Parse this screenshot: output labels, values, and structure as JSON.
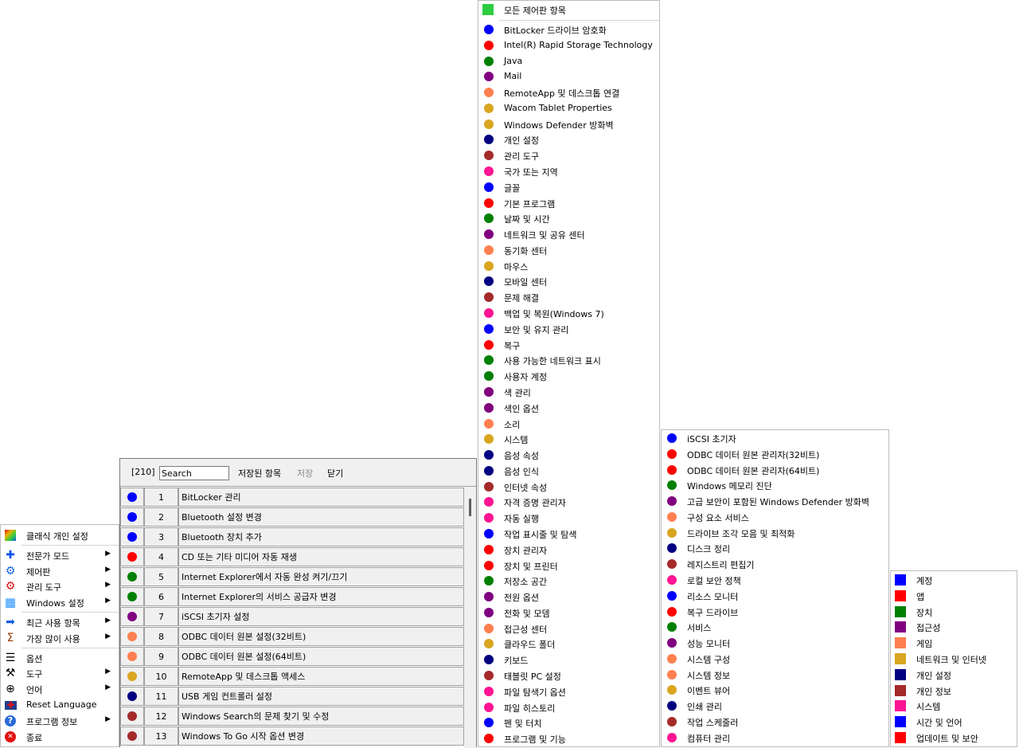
{
  "main_menu": {
    "items": [
      {
        "label": "클래식 개인 설정",
        "icon": "palette-icon",
        "color": "#e8b400",
        "submenu": false
      },
      {
        "sep": true
      },
      {
        "label": "전문가 모드",
        "icon": "plus-icon",
        "color": "#0050e6",
        "submenu": true
      },
      {
        "label": "제어판",
        "icon": "gear-icon",
        "color": "#1060e0",
        "submenu": true
      },
      {
        "label": "관리 도구",
        "icon": "gear-icon",
        "color": "#e01010",
        "submenu": true
      },
      {
        "label": "Windows 설정",
        "icon": "windows-icon",
        "color": "#1e90ff",
        "submenu": true
      },
      {
        "sep": true
      },
      {
        "label": "최근 사용 항목",
        "icon": "arrow-right-icon",
        "color": "#1060e0",
        "submenu": true
      },
      {
        "label": "가장 많이 사용",
        "icon": "sigma-icon",
        "color": "#9a3c00",
        "submenu": true
      },
      {
        "sep": true
      },
      {
        "label": "옵션",
        "icon": "sliders-icon",
        "color": "#000000",
        "submenu": false
      },
      {
        "label": "도구",
        "icon": "tools-icon",
        "color": "#000000",
        "submenu": true
      },
      {
        "label": "언어",
        "icon": "globe-icon",
        "color": "#000000",
        "submenu": true
      },
      {
        "label": "Reset Language",
        "icon": "uk-flag-icon",
        "color": "#1f3f8f",
        "submenu": false
      },
      {
        "label": "프로그램 정보",
        "icon": "help-icon",
        "color": "#2a6ad8",
        "submenu": true
      },
      {
        "label": "종료",
        "icon": "close-icon",
        "color": "#e01010",
        "submenu": false
      }
    ]
  },
  "dialog": {
    "count": "[210]",
    "search": {
      "value": "Search",
      "placeholder": "Search"
    },
    "saved_label": "저장된 항목",
    "save_label": "저장",
    "close_label": "닫기",
    "rows": [
      {
        "num": "1",
        "label": "BitLocker 관리",
        "color": "#0000ff"
      },
      {
        "num": "2",
        "label": "Bluetooth 설정 변경",
        "color": "#0000ff"
      },
      {
        "num": "3",
        "label": "Bluetooth 장치 추가",
        "color": "#0000ff"
      },
      {
        "num": "4",
        "label": "CD 또는 기타 미디어 자동 재생",
        "color": "#ff0000"
      },
      {
        "num": "5",
        "label": "Internet Explorer에서 자동 완성 켜기/끄기",
        "color": "#008000"
      },
      {
        "num": "6",
        "label": "Internet Explorer의 서비스 공급자 변경",
        "color": "#008000"
      },
      {
        "num": "7",
        "label": "iSCSI 초기자 설정",
        "color": "#800080"
      },
      {
        "num": "8",
        "label": "ODBC 데이터 원본 설정(32비트)",
        "color": "#ff7f50"
      },
      {
        "num": "9",
        "label": "ODBC 데이터 원본 설정(64비트)",
        "color": "#ff7f50"
      },
      {
        "num": "10",
        "label": "RemoteApp 및 데스크톱 액세스",
        "color": "#daa520"
      },
      {
        "num": "11",
        "label": "USB 게임 컨트롤러 설정",
        "color": "#000080"
      },
      {
        "num": "12",
        "label": "Windows Search의 문제 찾기 및 수정",
        "color": "#a52a2a"
      },
      {
        "num": "13",
        "label": "Windows To Go 시작 옵션 변경",
        "color": "#a52a2a"
      }
    ]
  },
  "control_panel_menu": {
    "header": {
      "label": "모든 제어판 항목",
      "color": "#2ecc40"
    },
    "items": [
      {
        "label": "BitLocker 드라이브 암호화",
        "color": "#0000ff"
      },
      {
        "label": "Intel(R) Rapid Storage Technology",
        "color": "#ff0000"
      },
      {
        "label": "Java",
        "color": "#008000"
      },
      {
        "label": "Mail",
        "color": "#800080"
      },
      {
        "label": "RemoteApp 및 데스크톱 연결",
        "color": "#ff7f50"
      },
      {
        "label": "Wacom Tablet Properties",
        "color": "#daa520"
      },
      {
        "label": "Windows Defender 방화벽",
        "color": "#daa520"
      },
      {
        "label": "개인 설정",
        "color": "#000080"
      },
      {
        "label": "관리 도구",
        "color": "#a52a2a"
      },
      {
        "label": "국가 또는 지역",
        "color": "#ff1493"
      },
      {
        "label": "글꼴",
        "color": "#0000ff"
      },
      {
        "label": "기본 프로그램",
        "color": "#ff0000"
      },
      {
        "label": "날짜 및 시간",
        "color": "#008000"
      },
      {
        "label": "네트워크 및 공유 센터",
        "color": "#800080"
      },
      {
        "label": "동기화 센터",
        "color": "#ff7f50"
      },
      {
        "label": "마우스",
        "color": "#daa520"
      },
      {
        "label": "모바일 센터",
        "color": "#000080"
      },
      {
        "label": "문제 해결",
        "color": "#a52a2a"
      },
      {
        "label": "백업 및 복원(Windows 7)",
        "color": "#ff1493"
      },
      {
        "label": "보안 및 유지 관리",
        "color": "#0000ff"
      },
      {
        "label": "복구",
        "color": "#ff0000"
      },
      {
        "label": "사용 가능한 네트워크 표시",
        "color": "#008000"
      },
      {
        "label": "사용자 계정",
        "color": "#008000"
      },
      {
        "label": "색 관리",
        "color": "#800080"
      },
      {
        "label": "색인 옵션",
        "color": "#800080"
      },
      {
        "label": "소리",
        "color": "#ff7f50"
      },
      {
        "label": "시스템",
        "color": "#daa520"
      },
      {
        "label": "음성 속성",
        "color": "#000080"
      },
      {
        "label": "음성 인식",
        "color": "#000080"
      },
      {
        "label": "인터넷 속성",
        "color": "#a52a2a"
      },
      {
        "label": "자격 증명 관리자",
        "color": "#ff1493"
      },
      {
        "label": "자동 실행",
        "color": "#ff1493"
      },
      {
        "label": "작업 표시줄 및 탐색",
        "color": "#0000ff"
      },
      {
        "label": "장치 관리자",
        "color": "#ff0000"
      },
      {
        "label": "장치 및 프린터",
        "color": "#ff0000"
      },
      {
        "label": "저장소 공간",
        "color": "#008000"
      },
      {
        "label": "전원 옵션",
        "color": "#800080"
      },
      {
        "label": "전화 및 모뎀",
        "color": "#800080"
      },
      {
        "label": "접근성 센터",
        "color": "#ff7f50"
      },
      {
        "label": "클라우드 폴더",
        "color": "#daa520"
      },
      {
        "label": "키보드",
        "color": "#000080"
      },
      {
        "label": "태블릿 PC 설정",
        "color": "#a52a2a"
      },
      {
        "label": "파일 탐색기 옵션",
        "color": "#ff1493"
      },
      {
        "label": "파일 히스토리",
        "color": "#ff1493"
      },
      {
        "label": "펜 및 터치",
        "color": "#0000ff"
      },
      {
        "label": "프로그램 및 기능",
        "color": "#ff0000"
      }
    ]
  },
  "admin_tools_menu": {
    "items": [
      {
        "label": "iSCSI 초기자",
        "color": "#0000ff"
      },
      {
        "label": "ODBC 데이터 원본 관리자(32비트)",
        "color": "#ff0000"
      },
      {
        "label": "ODBC 데이터 원본 관리자(64비트)",
        "color": "#ff0000"
      },
      {
        "label": "Windows 메모리 진단",
        "color": "#008000"
      },
      {
        "label": "고급 보안이 포함된 Windows Defender 방화벽",
        "color": "#800080"
      },
      {
        "label": "구성 요소 서비스",
        "color": "#ff7f50"
      },
      {
        "label": "드라이브 조각 모음 및 최적화",
        "color": "#daa520"
      },
      {
        "label": "디스크 정리",
        "color": "#000080"
      },
      {
        "label": "레지스트리 편집기",
        "color": "#a52a2a"
      },
      {
        "label": "로컬 보안 정책",
        "color": "#ff1493"
      },
      {
        "label": "리소스 모니터",
        "color": "#0000ff"
      },
      {
        "label": "복구 드라이브",
        "color": "#ff0000"
      },
      {
        "label": "서비스",
        "color": "#008000"
      },
      {
        "label": "성능 모니터",
        "color": "#800080"
      },
      {
        "label": "시스템 구성",
        "color": "#ff7f50"
      },
      {
        "label": "시스템 정보",
        "color": "#ff7f50"
      },
      {
        "label": "이벤트 뷰어",
        "color": "#daa520"
      },
      {
        "label": "인쇄 관리",
        "color": "#000080"
      },
      {
        "label": "작업 스케줄러",
        "color": "#a52a2a"
      },
      {
        "label": "컴퓨터 관리",
        "color": "#ff1493"
      }
    ]
  },
  "settings_menu": {
    "items": [
      {
        "label": "계정",
        "color": "#0000ff"
      },
      {
        "label": "앱",
        "color": "#ff0000"
      },
      {
        "label": "장치",
        "color": "#008000"
      },
      {
        "label": "접근성",
        "color": "#800080"
      },
      {
        "label": "게임",
        "color": "#ff7f50"
      },
      {
        "label": "네트워크 및 인터넷",
        "color": "#daa520"
      },
      {
        "label": "개인 설정",
        "color": "#000080"
      },
      {
        "label": "개인 정보",
        "color": "#a52a2a"
      },
      {
        "label": "시스템",
        "color": "#ff1493"
      },
      {
        "label": "시간 및 언어",
        "color": "#0000ff"
      },
      {
        "label": "업데이트 및 보안",
        "color": "#ff0000"
      }
    ]
  }
}
